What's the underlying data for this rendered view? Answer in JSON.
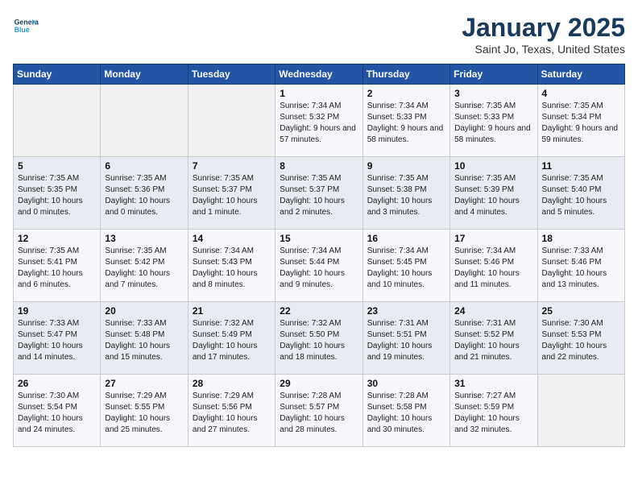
{
  "logo": {
    "line1": "General",
    "line2": "Blue"
  },
  "title": "January 2025",
  "subtitle": "Saint Jo, Texas, United States",
  "weekdays": [
    "Sunday",
    "Monday",
    "Tuesday",
    "Wednesday",
    "Thursday",
    "Friday",
    "Saturday"
  ],
  "weeks": [
    [
      {
        "day": "",
        "empty": true
      },
      {
        "day": "",
        "empty": true
      },
      {
        "day": "",
        "empty": true
      },
      {
        "day": "1",
        "sunrise": "7:34 AM",
        "sunset": "5:32 PM",
        "daylight": "9 hours and 57 minutes."
      },
      {
        "day": "2",
        "sunrise": "7:34 AM",
        "sunset": "5:33 PM",
        "daylight": "9 hours and 58 minutes."
      },
      {
        "day": "3",
        "sunrise": "7:35 AM",
        "sunset": "5:33 PM",
        "daylight": "9 hours and 58 minutes."
      },
      {
        "day": "4",
        "sunrise": "7:35 AM",
        "sunset": "5:34 PM",
        "daylight": "9 hours and 59 minutes."
      }
    ],
    [
      {
        "day": "5",
        "sunrise": "7:35 AM",
        "sunset": "5:35 PM",
        "daylight": "10 hours and 0 minutes."
      },
      {
        "day": "6",
        "sunrise": "7:35 AM",
        "sunset": "5:36 PM",
        "daylight": "10 hours and 0 minutes."
      },
      {
        "day": "7",
        "sunrise": "7:35 AM",
        "sunset": "5:37 PM",
        "daylight": "10 hours and 1 minute."
      },
      {
        "day": "8",
        "sunrise": "7:35 AM",
        "sunset": "5:37 PM",
        "daylight": "10 hours and 2 minutes."
      },
      {
        "day": "9",
        "sunrise": "7:35 AM",
        "sunset": "5:38 PM",
        "daylight": "10 hours and 3 minutes."
      },
      {
        "day": "10",
        "sunrise": "7:35 AM",
        "sunset": "5:39 PM",
        "daylight": "10 hours and 4 minutes."
      },
      {
        "day": "11",
        "sunrise": "7:35 AM",
        "sunset": "5:40 PM",
        "daylight": "10 hours and 5 minutes."
      }
    ],
    [
      {
        "day": "12",
        "sunrise": "7:35 AM",
        "sunset": "5:41 PM",
        "daylight": "10 hours and 6 minutes."
      },
      {
        "day": "13",
        "sunrise": "7:35 AM",
        "sunset": "5:42 PM",
        "daylight": "10 hours and 7 minutes."
      },
      {
        "day": "14",
        "sunrise": "7:34 AM",
        "sunset": "5:43 PM",
        "daylight": "10 hours and 8 minutes."
      },
      {
        "day": "15",
        "sunrise": "7:34 AM",
        "sunset": "5:44 PM",
        "daylight": "10 hours and 9 minutes."
      },
      {
        "day": "16",
        "sunrise": "7:34 AM",
        "sunset": "5:45 PM",
        "daylight": "10 hours and 10 minutes."
      },
      {
        "day": "17",
        "sunrise": "7:34 AM",
        "sunset": "5:46 PM",
        "daylight": "10 hours and 11 minutes."
      },
      {
        "day": "18",
        "sunrise": "7:33 AM",
        "sunset": "5:46 PM",
        "daylight": "10 hours and 13 minutes."
      }
    ],
    [
      {
        "day": "19",
        "sunrise": "7:33 AM",
        "sunset": "5:47 PM",
        "daylight": "10 hours and 14 minutes."
      },
      {
        "day": "20",
        "sunrise": "7:33 AM",
        "sunset": "5:48 PM",
        "daylight": "10 hours and 15 minutes."
      },
      {
        "day": "21",
        "sunrise": "7:32 AM",
        "sunset": "5:49 PM",
        "daylight": "10 hours and 17 minutes."
      },
      {
        "day": "22",
        "sunrise": "7:32 AM",
        "sunset": "5:50 PM",
        "daylight": "10 hours and 18 minutes."
      },
      {
        "day": "23",
        "sunrise": "7:31 AM",
        "sunset": "5:51 PM",
        "daylight": "10 hours and 19 minutes."
      },
      {
        "day": "24",
        "sunrise": "7:31 AM",
        "sunset": "5:52 PM",
        "daylight": "10 hours and 21 minutes."
      },
      {
        "day": "25",
        "sunrise": "7:30 AM",
        "sunset": "5:53 PM",
        "daylight": "10 hours and 22 minutes."
      }
    ],
    [
      {
        "day": "26",
        "sunrise": "7:30 AM",
        "sunset": "5:54 PM",
        "daylight": "10 hours and 24 minutes."
      },
      {
        "day": "27",
        "sunrise": "7:29 AM",
        "sunset": "5:55 PM",
        "daylight": "10 hours and 25 minutes."
      },
      {
        "day": "28",
        "sunrise": "7:29 AM",
        "sunset": "5:56 PM",
        "daylight": "10 hours and 27 minutes."
      },
      {
        "day": "29",
        "sunrise": "7:28 AM",
        "sunset": "5:57 PM",
        "daylight": "10 hours and 28 minutes."
      },
      {
        "day": "30",
        "sunrise": "7:28 AM",
        "sunset": "5:58 PM",
        "daylight": "10 hours and 30 minutes."
      },
      {
        "day": "31",
        "sunrise": "7:27 AM",
        "sunset": "5:59 PM",
        "daylight": "10 hours and 32 minutes."
      },
      {
        "day": "",
        "empty": true
      }
    ]
  ],
  "labels": {
    "sunrise": "Sunrise:",
    "sunset": "Sunset:",
    "daylight": "Daylight:"
  }
}
